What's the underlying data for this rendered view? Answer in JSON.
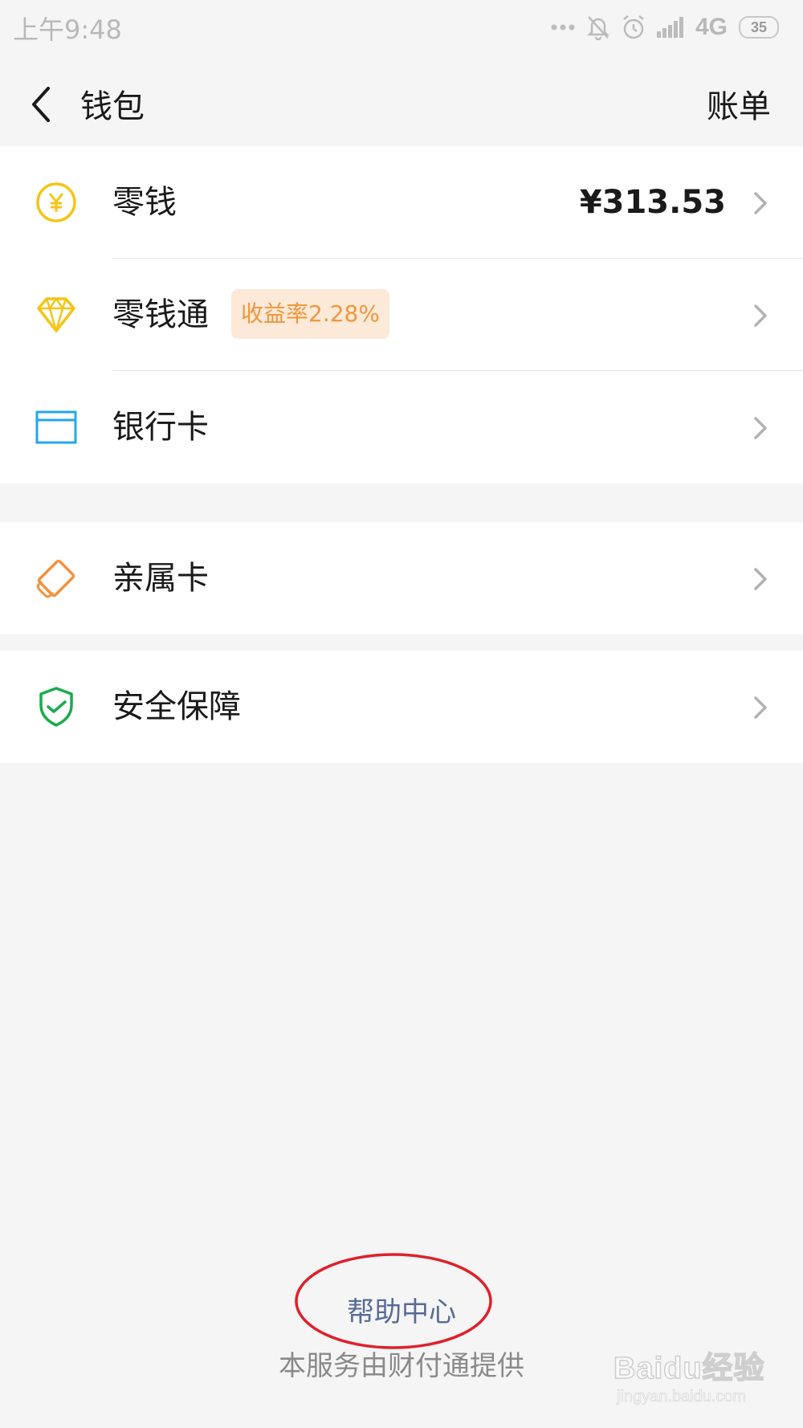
{
  "status_bar": {
    "time": "上午9:48",
    "network": "4G",
    "battery": "35",
    "icons": [
      "more-dots-icon",
      "mute-icon",
      "alarm-icon",
      "signal-icon",
      "battery-icon"
    ]
  },
  "header": {
    "title": "钱包",
    "bill_label": "账单",
    "back_icon": "back-arrow-icon"
  },
  "wallet_items": [
    {
      "label": "零钱",
      "value": "¥313.53",
      "icon": "coin-icon",
      "icon_color": "#f5c518"
    },
    {
      "label": "零钱通",
      "badge": "收益率2.28%",
      "icon": "diamond-icon",
      "icon_color": "#f5c518"
    },
    {
      "label": "银行卡",
      "icon": "bank-card-icon",
      "icon_color": "#23a6f2"
    }
  ],
  "family_card": {
    "label": "亲属卡",
    "icon": "family-card-icon",
    "icon_color": "#f5923c"
  },
  "security": {
    "label": "安全保障",
    "icon": "shield-check-icon",
    "icon_color": "#1aad4b"
  },
  "footer": {
    "help_label": "帮助中心",
    "provider_text": "本服务由财付通提供"
  },
  "watermark": {
    "logo": "Baidu经验",
    "url": "jingyan.baidu.com"
  },
  "colors": {
    "background": "#f5f5f5",
    "link": "#576b95",
    "badge_bg": "#fde9d8",
    "badge_text": "#f0963c",
    "annotation": "#e0202a"
  }
}
